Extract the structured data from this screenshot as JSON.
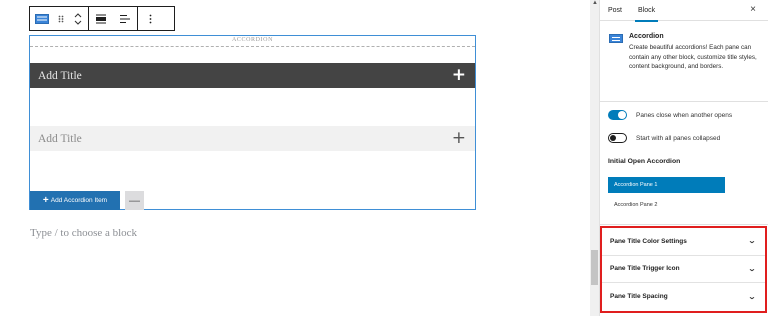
{
  "editor": {
    "accordion_label": "ACCORDION",
    "panes": [
      {
        "title": "Add Title",
        "toggle": "+"
      },
      {
        "title": "Add Title",
        "toggle": "+"
      }
    ],
    "add_item_label": "Add Accordion Item",
    "add_item_plus": "+",
    "remove_label": "—",
    "block_placeholder": "Type / to choose a block"
  },
  "toolbar": {
    "icons": [
      "accordion-block-icon",
      "drag-handle-icon",
      "move-up-down-icon",
      "align-full-icon",
      "align-left-icon",
      "more-options-icon"
    ]
  },
  "sidebar": {
    "tabs": [
      "Post",
      "Block"
    ],
    "active_tab": "Block",
    "close_label": "×",
    "block": {
      "title": "Accordion",
      "description": "Create beautiful accordions! Each pane can contain any other block, customize title styles, content background, and borders."
    },
    "toggles": [
      {
        "label": "Panes close when another opens",
        "on": true
      },
      {
        "label": "Start with all panes collapsed",
        "on": false
      }
    ],
    "initial_open": {
      "label": "Initial Open Accordion",
      "options": [
        "Accordion Pane 1",
        "Accordion Pane 2"
      ],
      "selected": "Accordion Pane 1"
    },
    "panels": [
      {
        "label": "Pane Title Color Settings",
        "chevron": "⌄"
      },
      {
        "label": "Pane Title Trigger Icon",
        "chevron": "⌄"
      },
      {
        "label": "Pane Title Spacing",
        "chevron": "⌄"
      }
    ]
  },
  "scrollbar": {
    "up_arrow": "▲"
  },
  "colors": {
    "accent": "#007cba",
    "pane_active_bg": "#444444",
    "highlight_border": "#e01e1e",
    "add_button": "#2271b1"
  }
}
